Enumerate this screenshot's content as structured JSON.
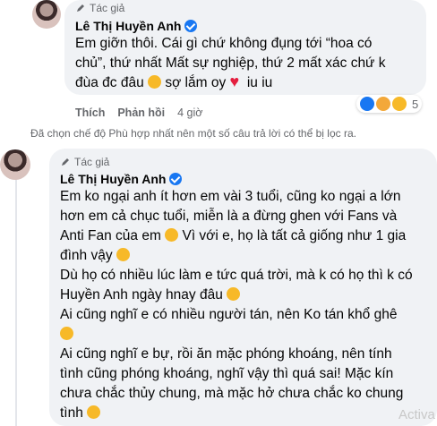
{
  "comment1": {
    "author_tag": "Tác giả",
    "author_name": "Lê Thị Huyền Anh",
    "text_line1": "Em giỡn thôi. Cái gì chứ không đụng tới “hoa có",
    "text_line2": "chủ”, thứ nhất Mất sự nghiệp, thứ 2 mất xác chứ k",
    "text_line3": "đùa đc đâu",
    "text_line3b": " sợ lắm oy ",
    "text_line3c": " iu iu",
    "like_label": "Thích",
    "reply_label": "Phản hồi",
    "time": "4 giờ",
    "reaction_count": "5"
  },
  "filter_note": "Đã chọn chế độ Phù hợp nhất nên một số câu trả lời có thể bị lọc ra.",
  "comment2": {
    "author_tag": "Tác giả",
    "author_name": "Lê Thị Huyền Anh",
    "lines": [
      "Em ko ngại anh ít hơn em vài 3 tuổi, cũng ko ngại a lớn",
      "hơn em cả chục tuổi, miễn là a đừng ghen với Fans và",
      "Anti Fan của em",
      " Vì với e, họ là tất cả giống như 1 gia",
      "đình vậy",
      "Dù họ có nhiều lúc làm e tức quá trời, mà k có họ thì k có",
      "Huyền Anh ngày hnay đâu",
      "Ai cũng nghĩ e có nhiều người tán, nên Ko tán khổ ghê",
      "Ai cũng nghĩ e bự, rồi ăn mặc phóng khoáng, nên tính",
      "tình cũng phóng khoáng, nghĩ vậy thì quá sai! Mặc kín",
      "chưa chắc thủy chung, mà mặc hở chưa chắc ko chung",
      "tình"
    ]
  },
  "watermark": "Activa"
}
